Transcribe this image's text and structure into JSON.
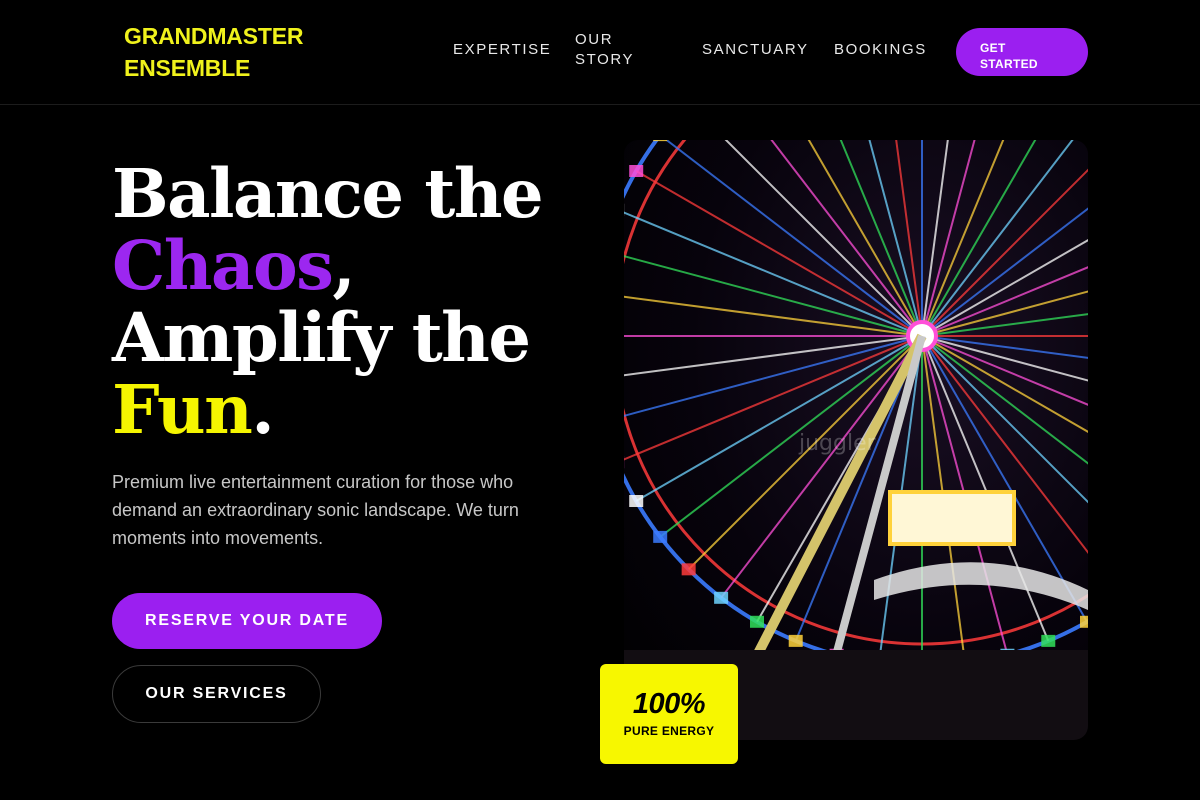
{
  "brand": {
    "name": "GRANDMASTER ENSEMBLE",
    "color": "#f0f21c"
  },
  "nav": {
    "items": [
      {
        "label": "EXPERTISE"
      },
      {
        "label": "OUR STORY"
      },
      {
        "label": "SANCTUARY"
      },
      {
        "label": "BOOKINGS"
      }
    ],
    "cta_label": "GET STARTED"
  },
  "hero": {
    "headline": {
      "line1": "Balance the",
      "accent1": "Chaos",
      "accent1_suffix": ",",
      "line3": "Amplify the",
      "accent2": "Fun",
      "accent2_suffix": "."
    },
    "description": "Premium live entertainment curation for those who demand an extraordinary sonic landscape. We turn moments into movements.",
    "primary_button": "RESERVE YOUR DATE",
    "secondary_button": "OUR SERVICES",
    "image_alt": "Illuminated ferris wheel at night above a crowd",
    "watermark": "juggler"
  },
  "badge": {
    "value": "100%",
    "label": "PURE ENERGY"
  },
  "colors": {
    "accent_purple": "#9b1ff0",
    "accent_yellow": "#f5f500",
    "background": "#000000"
  }
}
